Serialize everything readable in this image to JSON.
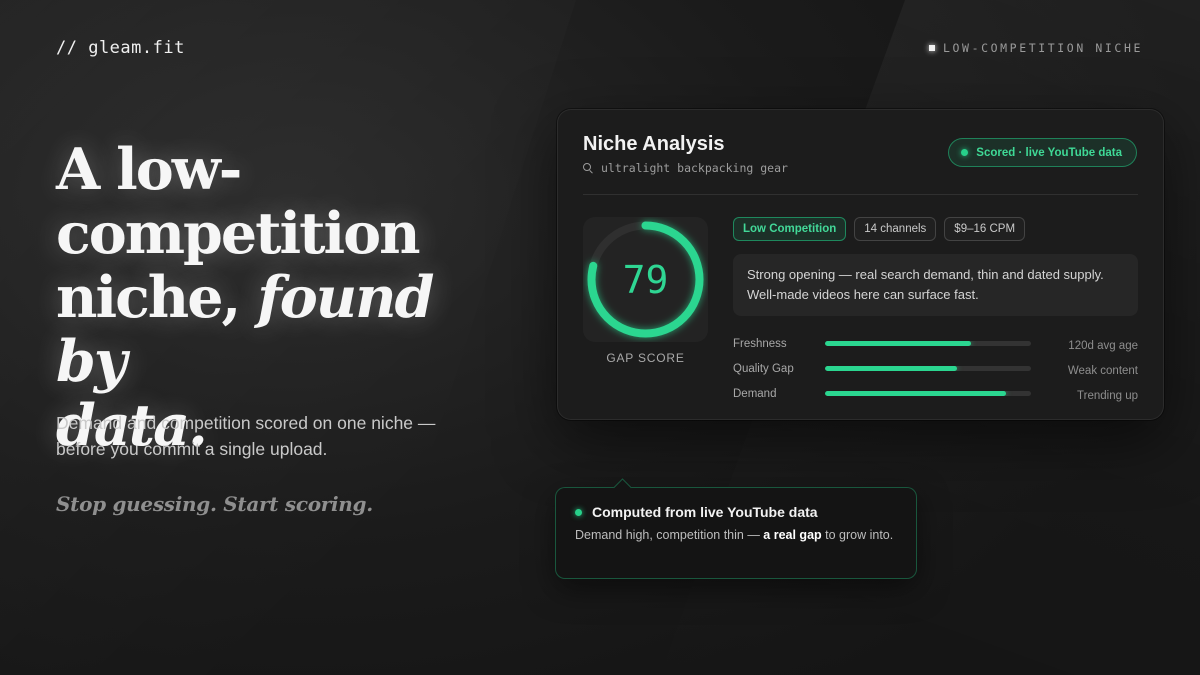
{
  "brand": {
    "logo": "// gleam.fit"
  },
  "top_tag": {
    "label": "LOW-COMPETITION NICHE"
  },
  "hero": {
    "headline_line1": "A low-",
    "headline_line2": "competition",
    "headline_line3a": "niche, ",
    "headline_line3b": "found by",
    "headline_line4": "data.",
    "subtext": "Demand and competition scored on one niche — before you commit a single upload.",
    "cta": "Stop guessing. Start scoring."
  },
  "card": {
    "title": "Niche Analysis",
    "query": "ultralight backpacking gear",
    "status": "Scored · live YouTube data",
    "score": "79",
    "score_fraction": 0.79,
    "score_label": "GAP SCORE",
    "pills": [
      "Low Competition",
      "14 channels",
      "$9–16 CPM"
    ],
    "summary": "Strong opening — real search demand, thin and dated supply. Well-made videos here can surface fast.",
    "metrics": [
      {
        "label": "Freshness",
        "value": 0.71,
        "note": "120d avg age"
      },
      {
        "label": "Quality Gap",
        "value": 0.64,
        "note": "Weak content"
      },
      {
        "label": "Demand",
        "value": 0.88,
        "note": "Trending up"
      }
    ]
  },
  "callout": {
    "title": "Computed from live YouTube data",
    "body_before": "Demand high, competition thin — ",
    "body_bold": "a real gap",
    "body_after": " to grow into."
  },
  "colors": {
    "accent": "#2bd690",
    "background": "#1b1b1b",
    "card": "#1c1c1c"
  }
}
